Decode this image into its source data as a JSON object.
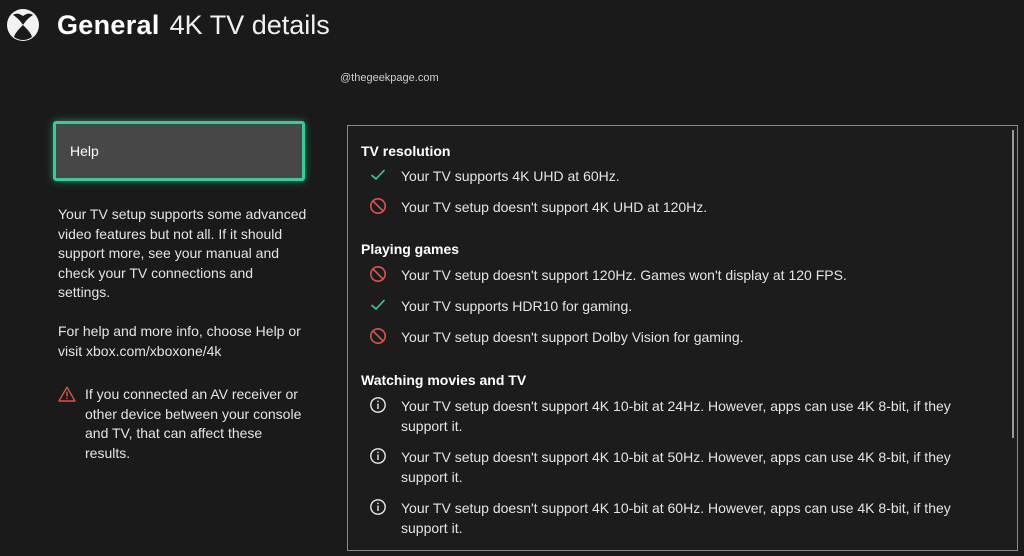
{
  "header": {
    "section": "General",
    "page_title": "4K TV details",
    "logo_icon": "xbox-logo-icon"
  },
  "watermark": "@thegeekpage.com",
  "left": {
    "help_button_label": "Help",
    "summary": "Your TV setup supports some advanced video features but not all. If it should support more, see your manual and check your TV connections and settings.",
    "help_info": "For help and more info, choose Help or visit xbox.com/xboxone/4k",
    "warning": "If you connected an AV receiver or other device between your console and TV, that can affect these results.",
    "warning_icon": "warning-triangle-icon"
  },
  "colors": {
    "accent": "#2fd09a",
    "check": "#2fd09a",
    "blocked": "#d9534f",
    "info": "#e8e8e8",
    "background": "#1a1a1a"
  },
  "sections": [
    {
      "title": "TV resolution",
      "items": [
        {
          "status": "supported",
          "icon": "check-icon",
          "text": "Your TV supports 4K UHD at 60Hz."
        },
        {
          "status": "unsupported",
          "icon": "blocked-icon",
          "text": "Your TV setup doesn't support 4K UHD at 120Hz."
        }
      ]
    },
    {
      "title": "Playing games",
      "items": [
        {
          "status": "unsupported",
          "icon": "blocked-icon",
          "text": "Your TV setup doesn't support 120Hz. Games won't display at 120 FPS."
        },
        {
          "status": "supported",
          "icon": "check-icon",
          "text": "Your TV supports HDR10 for gaming."
        },
        {
          "status": "unsupported",
          "icon": "blocked-icon",
          "text": "Your TV setup doesn't support Dolby Vision for gaming."
        }
      ]
    },
    {
      "title": "Watching movies and TV",
      "items": [
        {
          "status": "info",
          "icon": "info-icon",
          "text": "Your TV setup doesn't support 4K 10-bit at 24Hz. However, apps can use 4K 8-bit, if they support it."
        },
        {
          "status": "info",
          "icon": "info-icon",
          "text": "Your TV setup doesn't support 4K 10-bit at 50Hz. However, apps can use 4K 8-bit, if they support it."
        },
        {
          "status": "info",
          "icon": "info-icon",
          "text": "Your TV setup doesn't support 4K 10-bit at 60Hz. However, apps can use 4K 8-bit, if they support it."
        }
      ]
    }
  ]
}
